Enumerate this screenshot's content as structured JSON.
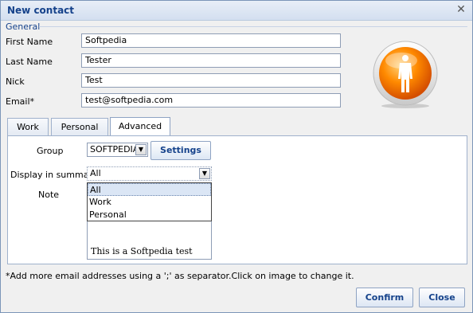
{
  "window": {
    "title": "New contact",
    "close_glyph": "✕"
  },
  "general": {
    "label": "General",
    "first_name": {
      "label": "First Name",
      "value": "Softpedia"
    },
    "last_name": {
      "label": "Last Name",
      "value": "Tester"
    },
    "nick": {
      "label": "Nick",
      "value": "Test"
    },
    "email": {
      "label": "Email*",
      "value": "test@softpedia.com"
    }
  },
  "avatar": {
    "icon": "person-icon",
    "accent": "#ff8a00"
  },
  "tabs": [
    {
      "label": "Work"
    },
    {
      "label": "Personal"
    },
    {
      "label": "Advanced",
      "active": true
    }
  ],
  "advanced": {
    "group_label": "Group",
    "group_value": "SOFTPEDIA",
    "settings_button": "Settings",
    "display_label": "Display in summary",
    "display_value": "All",
    "display_options": [
      "All",
      "Work",
      "Personal"
    ],
    "note_label": "Note",
    "note_text": "This is a Softpedia test"
  },
  "hint": "*Add more email addresses using a ';' as separator.Click on image to change it.",
  "buttons": {
    "confirm": "Confirm",
    "close": "Close"
  }
}
